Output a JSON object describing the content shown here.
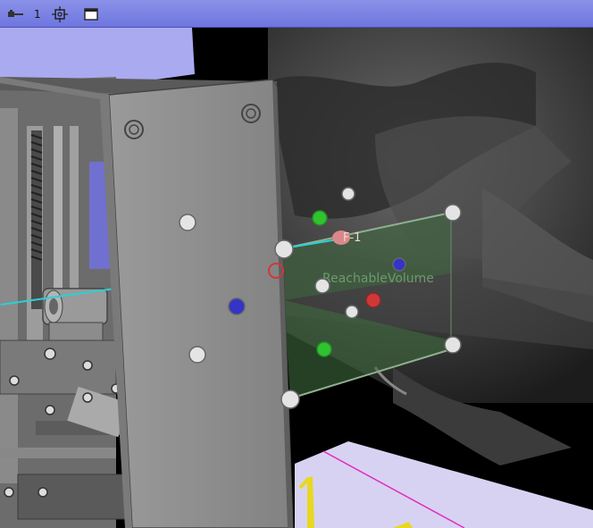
{
  "toolbar": {
    "pin_icon": "pin-icon",
    "layout_number": "1",
    "crosshair_icon": "crosshair-icon",
    "window_icon": "window-icon"
  },
  "viewport": {
    "volume_label": "ReachableVolume",
    "fiducial_label": "F-1"
  },
  "colors": {
    "toolbar_bg": "#7880e2",
    "robot_gray": "#8c8c8c",
    "volume_green": "#3e6a3e",
    "handle_white": "#e4e4e4",
    "handle_blue": "#3434c8",
    "handle_green": "#2ec42e",
    "handle_red": "#d03838",
    "needle_cyan": "#2ad0d8"
  }
}
